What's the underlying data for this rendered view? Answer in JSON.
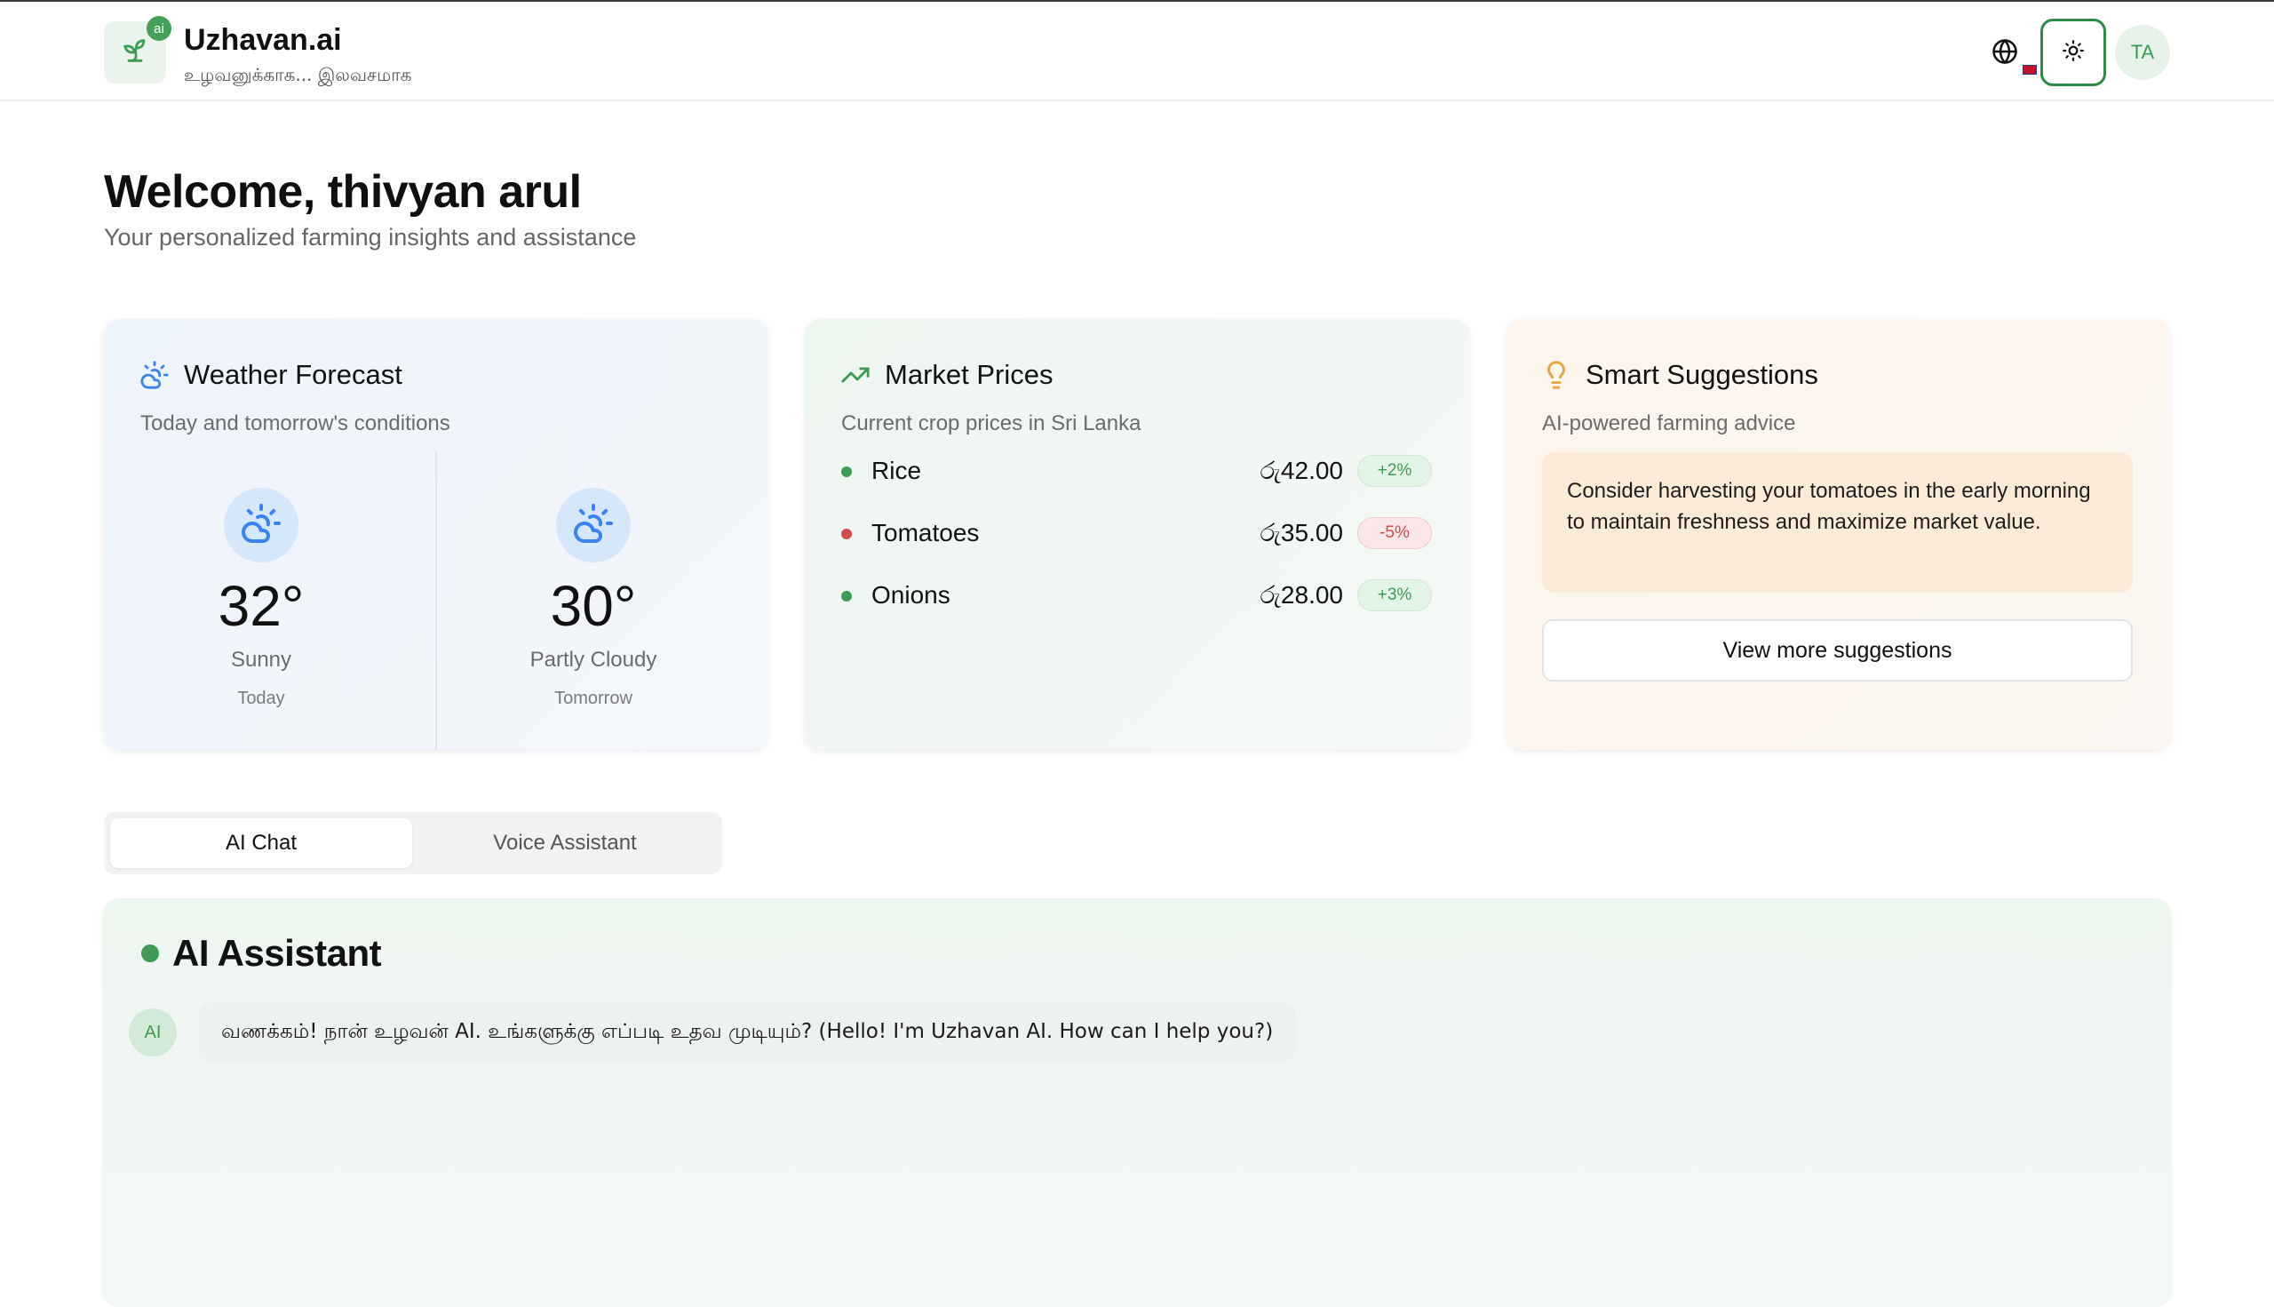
{
  "header": {
    "brand_title": "Uzhavan.ai",
    "brand_subtitle": "உழவனுக்காக... இலவசமாக",
    "logo_badge": "ai",
    "avatar_initials": "TA"
  },
  "welcome": {
    "title": "Welcome, thivyan arul",
    "subtitle": "Your personalized farming insights and assistance"
  },
  "weather": {
    "title": "Weather Forecast",
    "subtitle": "Today and tomorrow's conditions",
    "days": [
      {
        "temp": "32°",
        "condition": "Sunny",
        "day": "Today"
      },
      {
        "temp": "30°",
        "condition": "Partly Cloudy",
        "day": "Tomorrow"
      }
    ]
  },
  "market": {
    "title": "Market Prices",
    "subtitle": "Current crop prices in Sri Lanka",
    "items": [
      {
        "name": "Rice",
        "price": "රු42.00",
        "change": "+2%",
        "trend": "up"
      },
      {
        "name": "Tomatoes",
        "price": "රු35.00",
        "change": "-5%",
        "trend": "down"
      },
      {
        "name": "Onions",
        "price": "රු28.00",
        "change": "+3%",
        "trend": "up"
      }
    ]
  },
  "suggestions": {
    "title": "Smart Suggestions",
    "subtitle": "AI-powered farming advice",
    "text": "Consider harvesting your tomatoes in the early morning to maintain freshness and maximize market value.",
    "button_label": "View more suggestions"
  },
  "tabs": [
    {
      "label": "AI Chat",
      "active": true
    },
    {
      "label": "Voice Assistant",
      "active": false
    }
  ],
  "chat": {
    "title": "AI Assistant",
    "avatar_label": "AI",
    "message": "வணக்கம்! நான் உழவன் AI. உங்களுக்கு எப்படி உதவ முடியும்? (Hello! I'm Uzhavan AI. How can I help you?)"
  },
  "colors": {
    "accent": "#3f9a55",
    "up": "#3f9a55",
    "down": "#d24a4a",
    "weather_icon": "#3b82f6",
    "bulb": "#e6a23c"
  }
}
